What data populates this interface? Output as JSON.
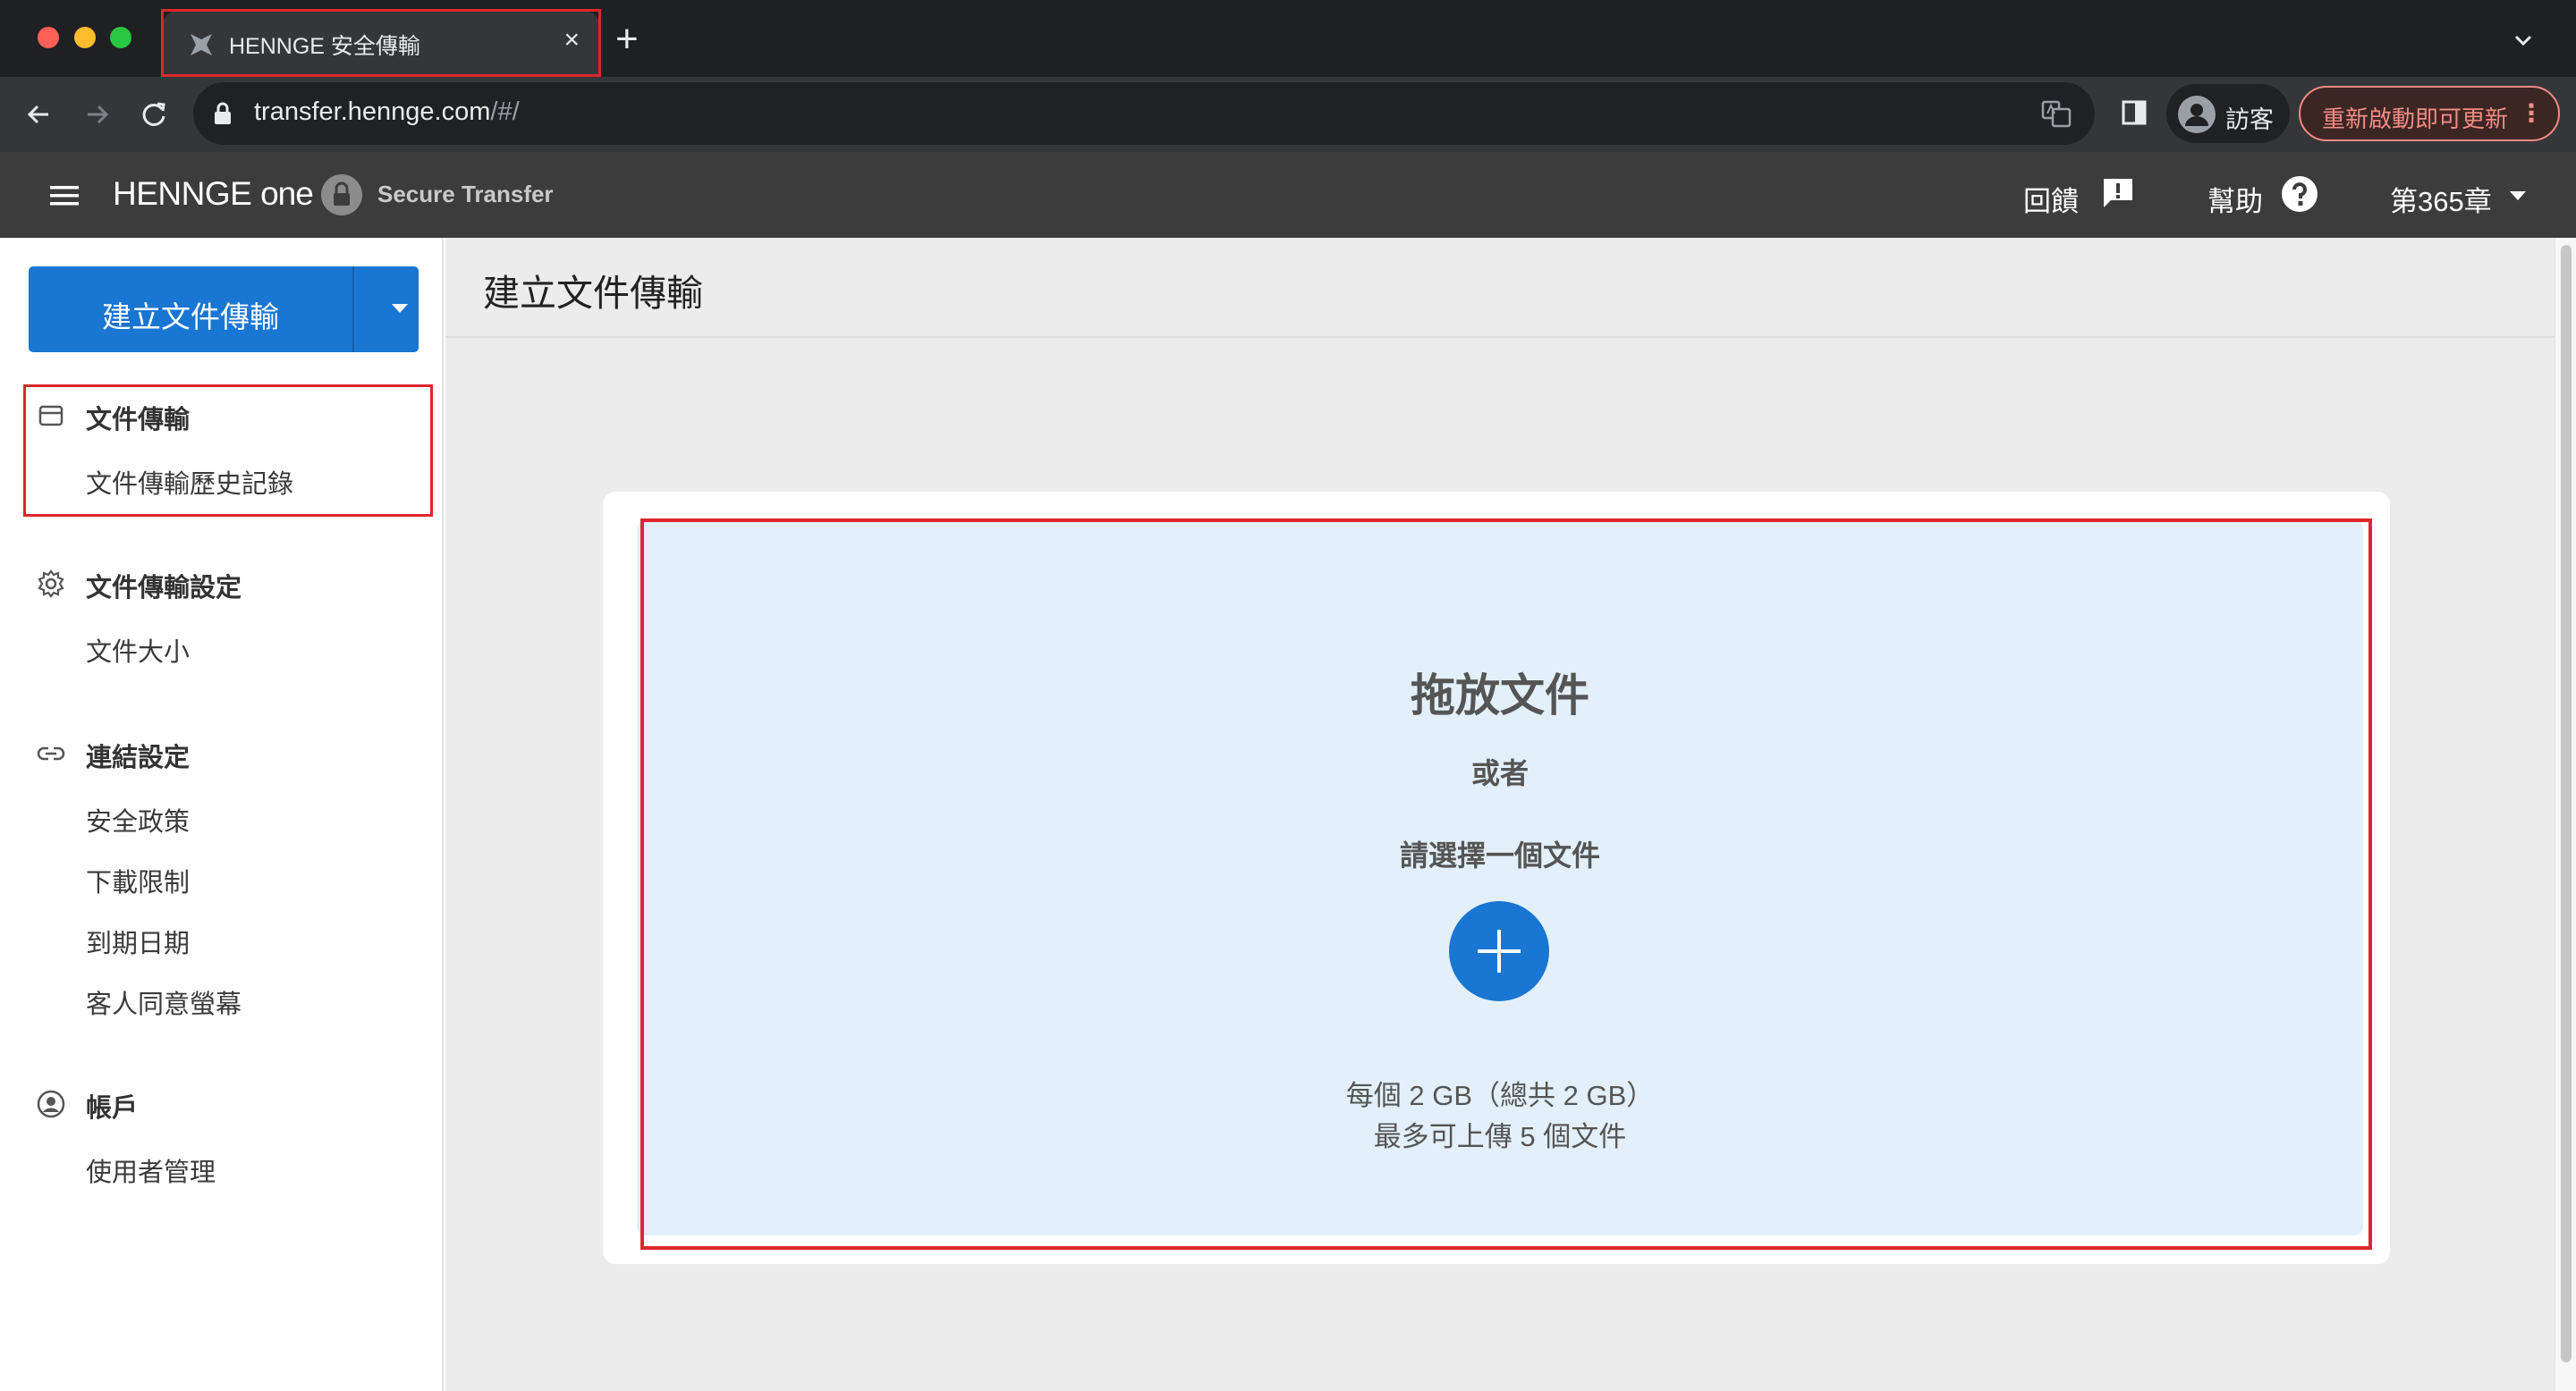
{
  "browser": {
    "tab_title": "HENNGE 安全傳輸",
    "tab_close": "×",
    "new_tab": "+",
    "url_host": "transfer.hennge.com",
    "url_path": "/#/",
    "profile_name": "訪客",
    "update_label": "重新啟動即可更新",
    "update_menu": "⋮"
  },
  "appbar": {
    "brand_main": "HENNGE",
    "brand_one": "one",
    "product_name": "Secure Transfer",
    "feedback_label": "回饋",
    "help_label": "幫助",
    "tenant_label": "第365章"
  },
  "sidebar": {
    "create_label": "建立文件傳輸",
    "groups": [
      {
        "label": "文件傳輸",
        "icon": "inbox-icon",
        "items": [
          "文件傳輸歷史記錄"
        ]
      },
      {
        "label": "文件傳輸設定",
        "icon": "gear-icon",
        "items": [
          "文件大小"
        ]
      },
      {
        "label": "連結設定",
        "icon": "link-icon",
        "items": [
          "安全政策",
          "下載限制",
          "到期日期",
          "客人同意螢幕"
        ]
      },
      {
        "label": "帳戶",
        "icon": "account-circle-icon",
        "items": [
          "使用者管理"
        ]
      }
    ]
  },
  "main": {
    "page_title": "建立文件傳輸",
    "dropzone": {
      "title": "拖放文件",
      "or": "或者",
      "select": "請選擇一個文件",
      "limit_line1": "每個 2 GB（總共 2 GB）",
      "limit_line2": "最多可上傳 5 個文件"
    }
  },
  "colors": {
    "accent": "#1976d2",
    "dropzone_bg": "#e3f0fb",
    "appbar_bg": "#3c3c3c",
    "highlight": "#e0262b",
    "update_text": "#f28b82"
  }
}
